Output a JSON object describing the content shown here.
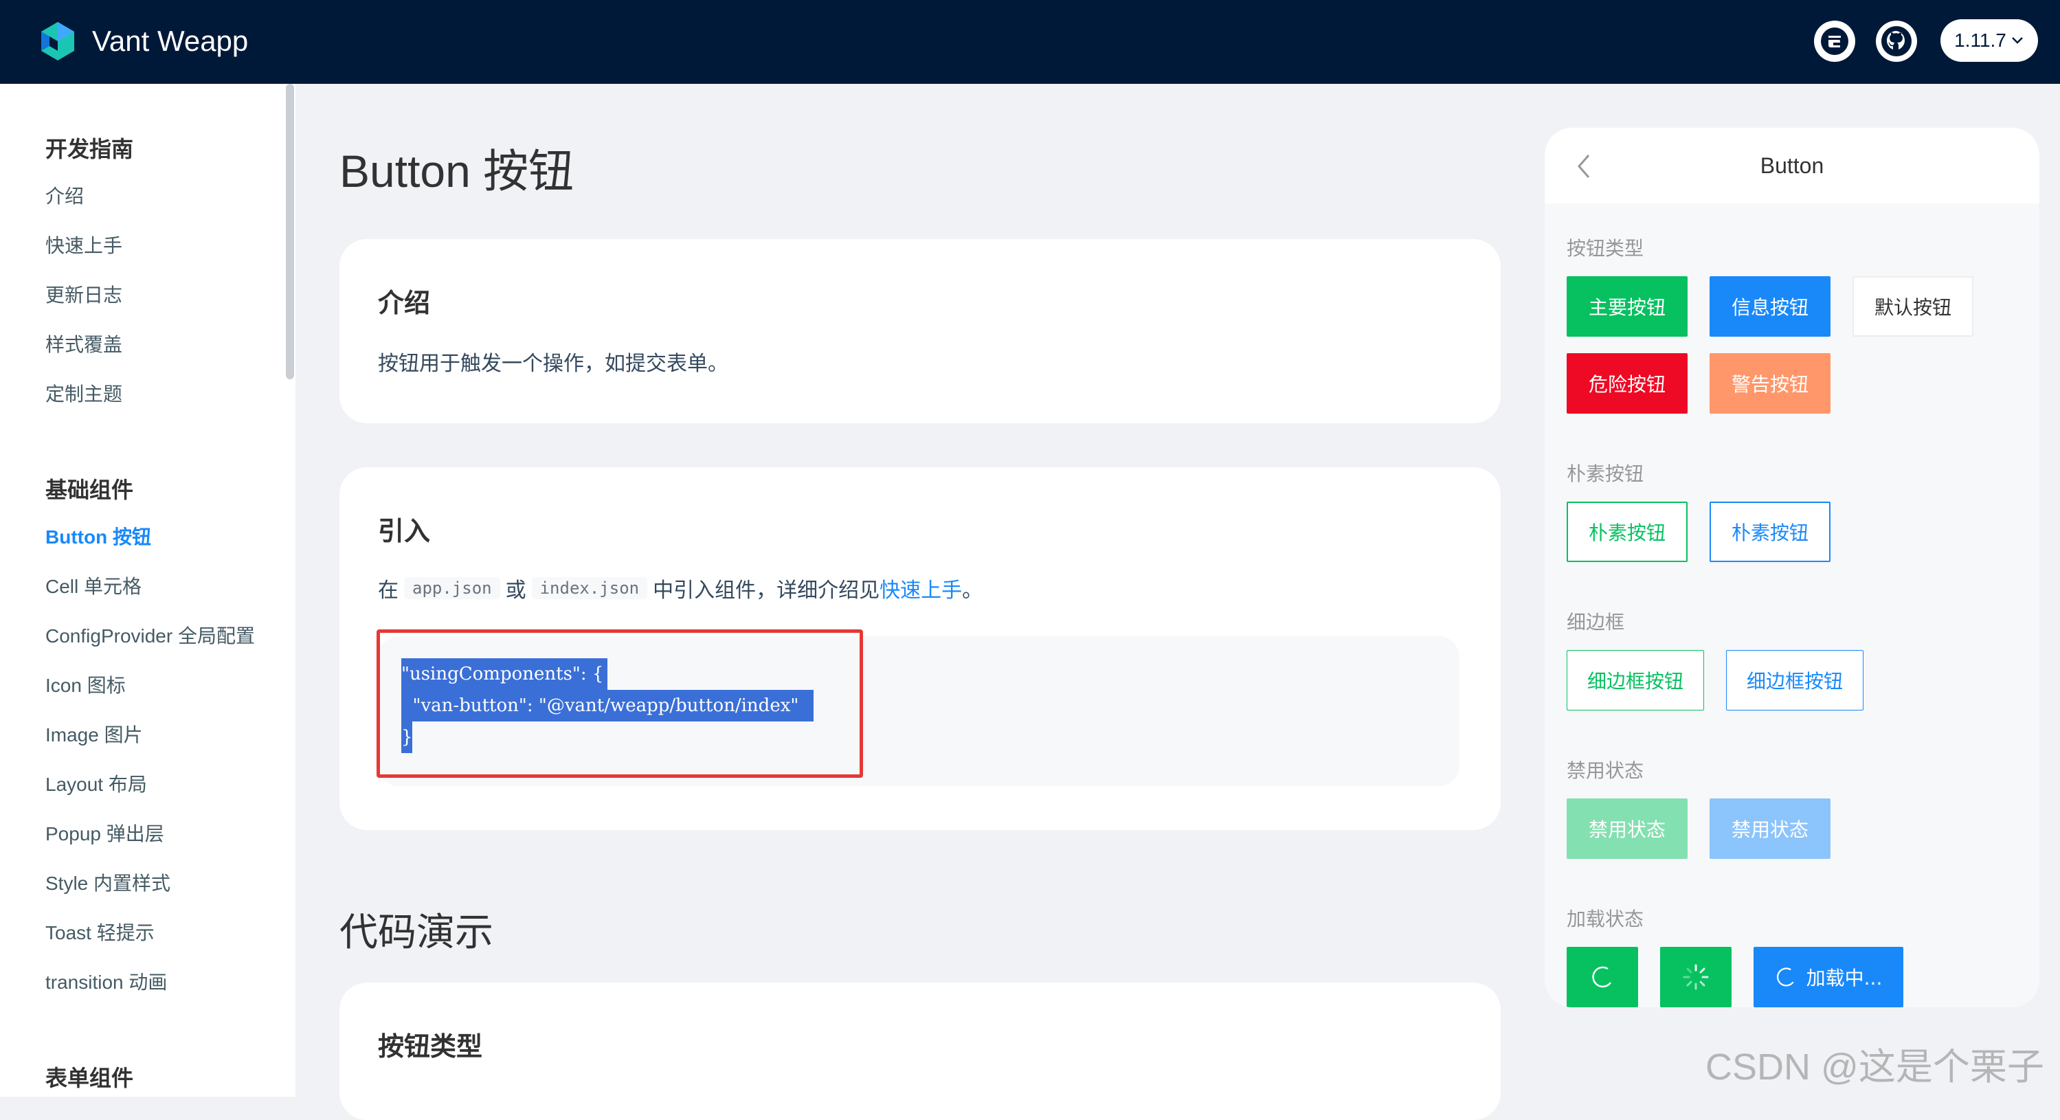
{
  "header": {
    "brand": "Vant Weapp",
    "version": "1.11.7",
    "icons": [
      "gitee-icon",
      "github-icon",
      "chevron-down-icon"
    ]
  },
  "sidebar": {
    "groups": [
      {
        "title": "开发指南",
        "items": [
          "介绍",
          "快速上手",
          "更新日志",
          "样式覆盖",
          "定制主题"
        ]
      },
      {
        "title": "基础组件",
        "items": [
          "Button 按钮",
          "Cell 单元格",
          "ConfigProvider 全局配置",
          "Icon 图标",
          "Image 图片",
          "Layout 布局",
          "Popup 弹出层",
          "Style 内置样式",
          "Toast 轻提示",
          "transition 动画"
        ]
      },
      {
        "title": "表单组件",
        "items": []
      }
    ],
    "active_item": "Button 按钮"
  },
  "main": {
    "title": "Button 按钮",
    "intro": {
      "title": "介绍",
      "text": "按钮用于触发一个操作，如提交表单。"
    },
    "import": {
      "title": "引入",
      "text_prefix": "在",
      "code1": "app.json",
      "text_or": "或",
      "code2": "index.json",
      "text_middle": "中引入组件，详细介绍见",
      "link": "快速上手",
      "text_end": "。",
      "code_lines": [
        "\"usingComponents\": {",
        "  \"van-button\": \"@vant/weapp/button/index\"",
        "}"
      ]
    },
    "demo_title": "代码演示",
    "demo_card_title": "按钮类型"
  },
  "preview": {
    "nav_title": "Button",
    "sections": {
      "types": "按钮类型",
      "plain": "朴素按钮",
      "hairline": "细边框",
      "disabled": "禁用状态",
      "loading": "加载状态"
    },
    "buttons": {
      "primary": "主要按钮",
      "info": "信息按钮",
      "default": "默认按钮",
      "danger": "危险按钮",
      "warning": "警告按钮",
      "plain1": "朴素按钮",
      "plain2": "朴素按钮",
      "hairline1": "细边框按钮",
      "hairline2": "细边框按钮",
      "disabled1": "禁用状态",
      "disabled2": "禁用状态",
      "loading_text": "加载中..."
    },
    "colors": {
      "primary": "#07c160",
      "info": "#1989fa",
      "danger": "#ee0a24",
      "warning": "#ff976a"
    }
  },
  "watermark": "CSDN @这是个栗子"
}
